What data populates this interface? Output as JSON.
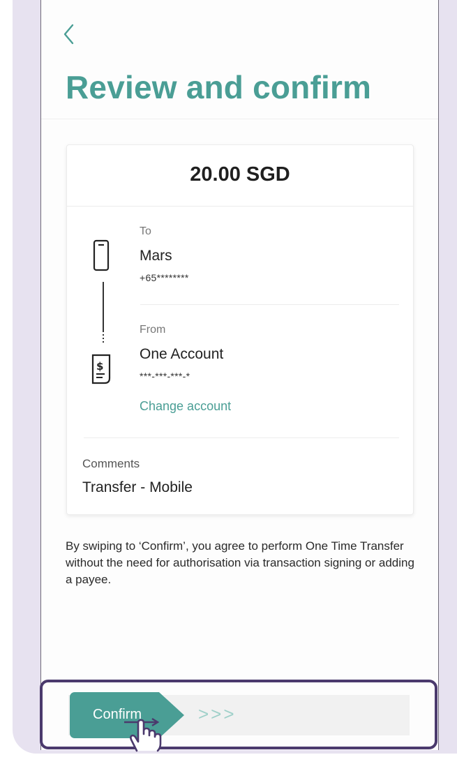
{
  "header": {
    "back_icon": "chevron-left-icon",
    "title": "Review and confirm"
  },
  "card": {
    "amount": "20.00 SGD",
    "to": {
      "label": "To",
      "name": "Mars",
      "number": "+65********"
    },
    "from": {
      "label": "From",
      "name": "One Account",
      "number": "***-***-***-*",
      "change_label": "Change account"
    },
    "comments": {
      "label": "Comments",
      "value": "Transfer - Mobile"
    }
  },
  "disclaimer": "By swiping to ‘Confirm’, you agree to perform One Time Transfer without the need for authorisation via transaction signing or adding a payee.",
  "swipe": {
    "label": "Confirm",
    "chevrons": ">>>"
  },
  "colors": {
    "accent": "#4a9e95",
    "frame_background": "#e7e2f0",
    "highlight": "#4b3a6d"
  }
}
